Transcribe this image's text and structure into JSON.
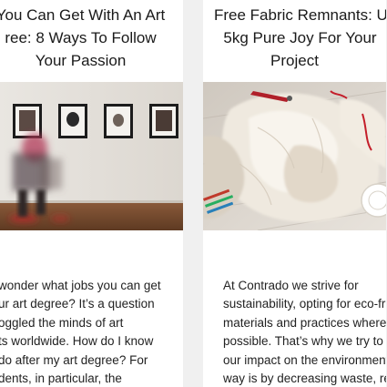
{
  "articles": [
    {
      "title_lines": [
        "You Can Get With An Art",
        "ree: 8 Ways To Follow",
        "Your Passion"
      ],
      "image_alt": "gallery-photo",
      "excerpt_lines": [
        "wonder what jobs you can get",
        "ur art degree? It’s a question",
        "oggled the minds of art",
        "ts worldwide. How do I know",
        "do after my art degree? For",
        "dents, in particular, the"
      ]
    },
    {
      "title_lines": [
        "Free Fabric Remnants: U",
        "5kg Pure Joy For Your",
        "Project"
      ],
      "image_alt": "fabric-remnants-photo",
      "excerpt_lines": [
        "At Contrado we strive for",
        "sustainability, opting for eco-fr",
        "materials and practices wherev",
        "possible. That’s why we try to r",
        "our impact on the environment",
        "way is by decreasing waste, re"
      ]
    }
  ]
}
